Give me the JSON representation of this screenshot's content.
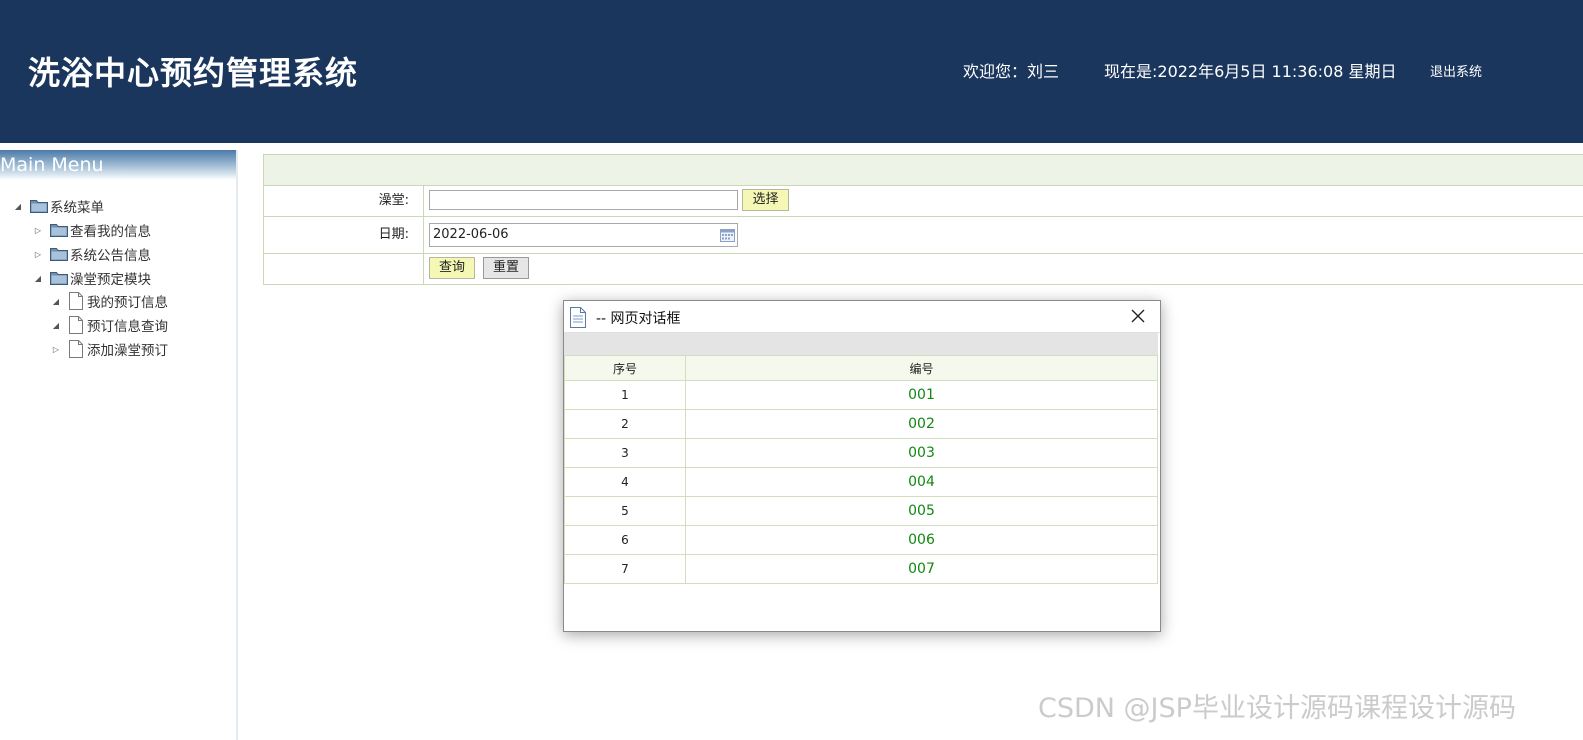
{
  "header": {
    "title": "洗浴中心预约管理系统",
    "welcome": "欢迎您：刘三",
    "now": "现在是:2022年6月5日 11:36:08 星期日",
    "logout": "退出系统"
  },
  "sidebar": {
    "title": "Main Menu",
    "items": [
      {
        "label": "系统菜单"
      },
      {
        "label": "查看我的信息"
      },
      {
        "label": "系统公告信息"
      },
      {
        "label": "澡堂预定模块"
      },
      {
        "label": "我的预订信息"
      },
      {
        "label": "预订信息查询"
      },
      {
        "label": "添加澡堂预订"
      }
    ]
  },
  "form": {
    "bath_label": "澡堂:",
    "bath_value": "",
    "select_button": "选择",
    "date_label": "日期:",
    "date_value": "2022-06-06",
    "query_button": "查询",
    "reset_button": "重置"
  },
  "dialog": {
    "title": "-- 网页对话框",
    "columns": [
      "序号",
      "编号"
    ],
    "rows": [
      {
        "index": "1",
        "code": "001"
      },
      {
        "index": "2",
        "code": "002"
      },
      {
        "index": "3",
        "code": "003"
      },
      {
        "index": "4",
        "code": "004"
      },
      {
        "index": "5",
        "code": "005"
      },
      {
        "index": "6",
        "code": "006"
      },
      {
        "index": "7",
        "code": "007"
      }
    ]
  },
  "watermark": "CSDN @JSP毕业设计源码课程设计源码"
}
